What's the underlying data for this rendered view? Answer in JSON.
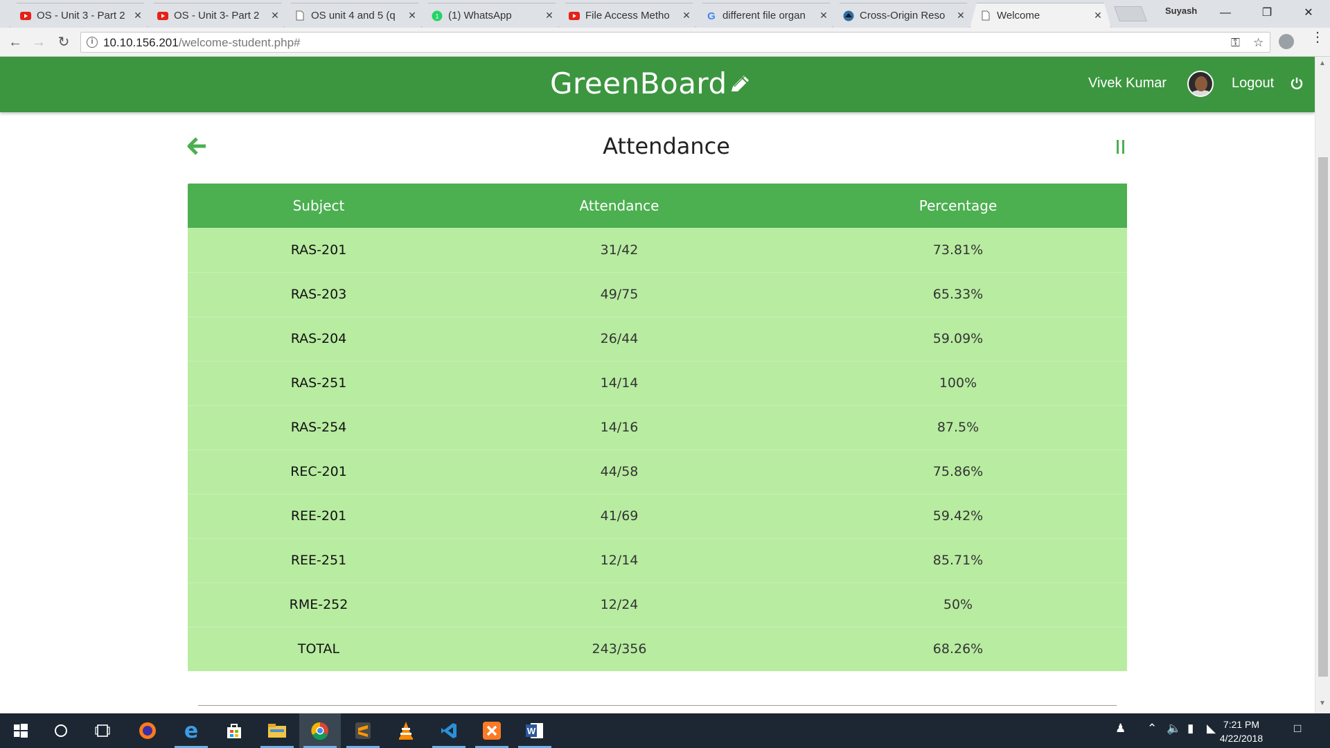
{
  "browser": {
    "tabs": [
      {
        "title": "OS - Unit 3 - Part 2",
        "icon": "youtube-icon",
        "active": false
      },
      {
        "title": "OS - Unit 3- Part 2",
        "icon": "youtube-icon",
        "active": false
      },
      {
        "title": "OS unit 4 and 5 (q",
        "icon": "document-icon",
        "active": false
      },
      {
        "title": "(1) WhatsApp",
        "icon": "whatsapp-icon",
        "active": false
      },
      {
        "title": "File Access Metho",
        "icon": "youtube-icon",
        "active": false
      },
      {
        "title": "different file organ",
        "icon": "google-icon",
        "active": false
      },
      {
        "title": "Cross-Origin Reso",
        "icon": "mdn-icon",
        "active": false
      },
      {
        "title": "Welcome",
        "icon": "document-icon",
        "active": true
      }
    ],
    "profile_name": "Suyash",
    "url_host": "10.10.156.201",
    "url_path": "/welcome-student.php#"
  },
  "app": {
    "brand": "GreenBoard",
    "user_name": "Vivek Kumar",
    "logout_label": "Logout",
    "accent_color": "#3c963f"
  },
  "page": {
    "title": "Attendance",
    "columns": [
      "Subject",
      "Attendance",
      "Percentage"
    ],
    "rows": [
      {
        "subject": "RAS-201",
        "attendance": "31/42",
        "percentage": "73.81%"
      },
      {
        "subject": "RAS-203",
        "attendance": "49/75",
        "percentage": "65.33%"
      },
      {
        "subject": "RAS-204",
        "attendance": "26/44",
        "percentage": "59.09%"
      },
      {
        "subject": "RAS-251",
        "attendance": "14/14",
        "percentage": "100%"
      },
      {
        "subject": "RAS-254",
        "attendance": "14/16",
        "percentage": "87.5%"
      },
      {
        "subject": "REC-201",
        "attendance": "44/58",
        "percentage": "75.86%"
      },
      {
        "subject": "REE-201",
        "attendance": "41/69",
        "percentage": "59.42%"
      },
      {
        "subject": "REE-251",
        "attendance": "12/14",
        "percentage": "85.71%"
      },
      {
        "subject": "RME-252",
        "attendance": "12/24",
        "percentage": "50%"
      },
      {
        "subject": "TOTAL",
        "attendance": "243/356",
        "percentage": "68.26%"
      }
    ]
  },
  "taskbar": {
    "time": "7:21 PM",
    "date": "4/22/2018",
    "apps": [
      "start-icon",
      "cortana-icon",
      "task-view-icon",
      "firefox-icon",
      "edge-icon",
      "store-icon",
      "file-explorer-icon",
      "chrome-icon",
      "sublime-icon",
      "vlc-icon",
      "vscode-icon",
      "xampp-icon",
      "word-icon"
    ]
  }
}
